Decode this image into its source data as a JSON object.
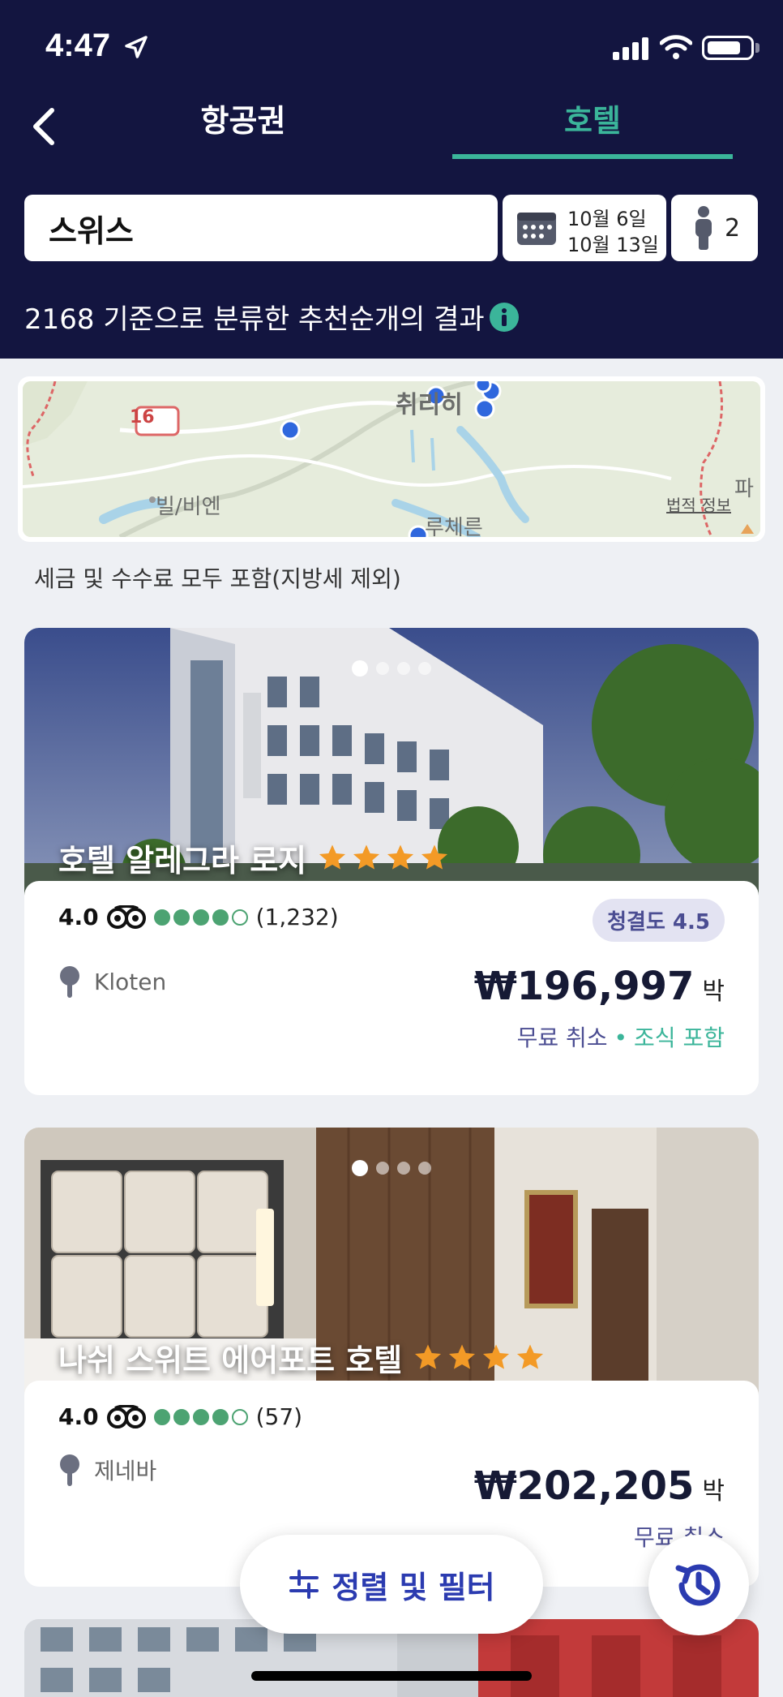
{
  "status_bar": {
    "time": "4:47"
  },
  "tabs": {
    "flights": "항공권",
    "hotels": "호텔"
  },
  "search": {
    "destination": "스위스",
    "check_in": "10월 6일",
    "check_out": "10월 13일",
    "guests": "2"
  },
  "results_text": "2168 기준으로 분류한 추천순개의 결과",
  "map": {
    "labels": {
      "zurich": "취리히",
      "biel": "빌/비엔",
      "lucerne": "루체른",
      "road": "16",
      "edge": "파"
    },
    "legal": "법적 정보"
  },
  "tax_note": "세금 및 수수료 모두 포함(지방세 제외)",
  "hotels": [
    {
      "name": "호텔 알레그라 로지",
      "stars": 4,
      "rating": "4.0",
      "bubbles": 4,
      "reviews": "(1,232)",
      "cleanliness": "청결도 4.5",
      "location": "Kloten",
      "price": "₩196,997",
      "per": "박",
      "cancel": "무료 취소",
      "sep": "•",
      "breakfast": "조식 포함",
      "photo_index": 1,
      "photo_count": 4
    },
    {
      "name": "나쉬 스위트 에어포트 호텔",
      "stars": 4,
      "rating": "4.0",
      "bubbles": 4,
      "reviews": "(57)",
      "location": "제네바",
      "price": "₩202,205",
      "per": "박",
      "cancel": "무료 취소",
      "photo_index": 1,
      "photo_count": 4
    }
  ],
  "sort_filter_label": "정렬 및 필터",
  "colors": {
    "header": "#131540",
    "accent_green": "#3bb59a",
    "accent_blue": "#2b3bb0",
    "star": "#f39a26",
    "bubble": "#4ca372"
  }
}
